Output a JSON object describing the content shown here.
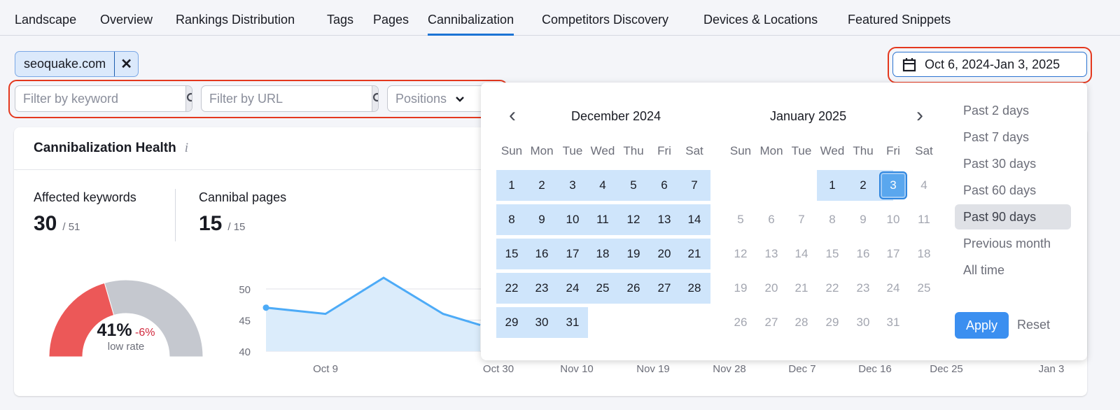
{
  "tabs": [
    {
      "label": "Landscape"
    },
    {
      "label": "Overview"
    },
    {
      "label": "Rankings Distribution"
    },
    {
      "label": "Tags"
    },
    {
      "label": "Pages"
    },
    {
      "label": "Cannibalization",
      "active": true
    },
    {
      "label": "Competitors Discovery"
    },
    {
      "label": "Devices & Locations"
    },
    {
      "label": "Featured Snippets"
    }
  ],
  "domain_chip": {
    "label": "seoquake.com",
    "remove": "✕"
  },
  "filters": {
    "keyword_placeholder": "Filter by keyword",
    "url_placeholder": "Filter by URL",
    "positions_label": "Positions"
  },
  "date_range": {
    "label": "Oct 6, 2024-Jan 3, 2025"
  },
  "card": {
    "title": "Cannibalization Health",
    "info": "i",
    "affected": {
      "label": "Affected keywords",
      "value": "30",
      "total": "/ 51"
    },
    "pages": {
      "label": "Cannibal pages",
      "value": "15",
      "total": "/ 15"
    },
    "gauge": {
      "percent": 41,
      "value": "41%",
      "delta": "-6%",
      "caption": "low rate",
      "colors": {
        "fill": "#ec5858",
        "rest": "#c5c8cf",
        "delta": "#d1293d"
      }
    }
  },
  "chart_data": {
    "type": "area",
    "y_ticks": [
      "50",
      "45",
      "40"
    ],
    "ylim": [
      40,
      50
    ],
    "x_ticks": [
      "Oct 9",
      "Oct 30",
      "Nov 10",
      "Nov 19",
      "Nov 28",
      "Dec 7",
      "Dec 16",
      "Dec 25",
      "Jan 3"
    ],
    "visible_values": [
      47,
      46,
      51.8,
      46,
      44.2
    ],
    "color": "#4dabf7"
  },
  "calendar": {
    "weekdays": [
      "Sun",
      "Mon",
      "Tue",
      "Wed",
      "Thu",
      "Fri",
      "Sat"
    ],
    "left": {
      "title": "December 2024"
    },
    "right": {
      "title": "January 2025"
    },
    "selected_day": "3",
    "presets": [
      "Past 2 days",
      "Past 7 days",
      "Past 30 days",
      "Past 60 days",
      "Past 90 days",
      "Previous month",
      "All time"
    ],
    "active_preset": "Past 90 days",
    "apply": "Apply",
    "reset": "Reset",
    "prev": "‹",
    "next": "›"
  }
}
